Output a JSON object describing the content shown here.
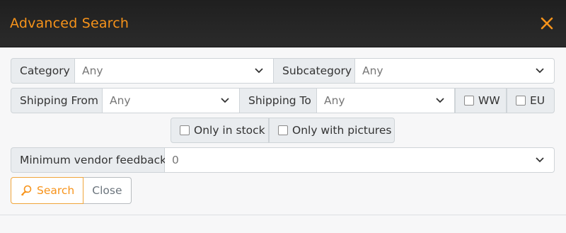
{
  "modal": {
    "title": "Advanced Search",
    "close_icon": "close-icon"
  },
  "filters": {
    "category": {
      "label": "Category",
      "value": "Any"
    },
    "subcategory": {
      "label": "Subcategory",
      "value": "Any"
    },
    "shipping_from": {
      "label": "Shipping From",
      "value": "Any"
    },
    "shipping_to": {
      "label": "Shipping To",
      "value": "Any"
    },
    "ww": {
      "label": "WW",
      "checked": false
    },
    "eu": {
      "label": "EU",
      "checked": false
    },
    "only_in_stock": {
      "label": "Only in stock",
      "checked": false
    },
    "only_with_pictures": {
      "label": "Only with pictures",
      "checked": false
    },
    "min_vendor_feedback": {
      "label": "Minimum vendor feedback",
      "value": "0"
    }
  },
  "actions": {
    "search_label": "Search",
    "search_icon": "user-search-icon",
    "close_label": "Close"
  },
  "colors": {
    "accent": "#f7931a",
    "header_bg": "#262626",
    "label_bg": "#e9ecef",
    "border": "#cfd4d8"
  }
}
